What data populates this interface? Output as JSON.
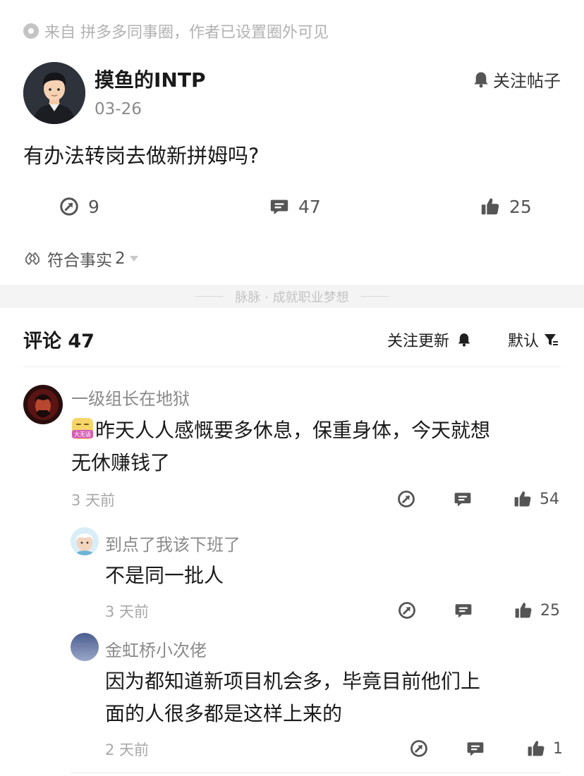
{
  "post": {
    "source_text": "来自 拼多多同事圈，作者已设置圈外可见",
    "author_name": "摸鱼的INTP",
    "date": "03-26",
    "follow_label": "关注帖子",
    "content": "有办法转岗去做新拼姆吗?",
    "shares": "9",
    "comments": "47",
    "likes": "25",
    "fact_label": "符合事实",
    "fact_count": "2"
  },
  "divider_text": "脉脉 · 成就职业梦想",
  "comments_header": {
    "title": "评论 47",
    "follow_update_label": "关注更新",
    "sort_label": "默认"
  },
  "comments": [
    {
      "name": "一级组长在地狱",
      "badge_text": "大无语",
      "text_line1": "昨天人人感慨要多休息，保重身体，今天就想",
      "text_line2": "无休赚钱了",
      "time": "3 天前",
      "likes": "54"
    },
    {
      "name": "到点了我该下班了",
      "text_line1": "不是同一批人",
      "time": "3 天前",
      "likes": "25"
    },
    {
      "name": "金虹桥小次佬",
      "text_line1": "因为都知道新项目机会多，毕竟目前他们上",
      "text_line2": "面的人很多都是这样上来的",
      "time": "2 天前",
      "likes": "1"
    }
  ],
  "icons": {
    "source": "circle-dot-icon",
    "bell": "bell-icon",
    "share": "share-icon",
    "comment": "comment-icon",
    "like": "thumbs-up-icon",
    "fact": "hands-icon",
    "sort": "filter-icon"
  },
  "colors": {
    "text_primary": "#1a1a1a",
    "text_secondary": "#8a8a8a",
    "icon_gray": "#555555",
    "divider_bg": "#f4f4f4"
  }
}
